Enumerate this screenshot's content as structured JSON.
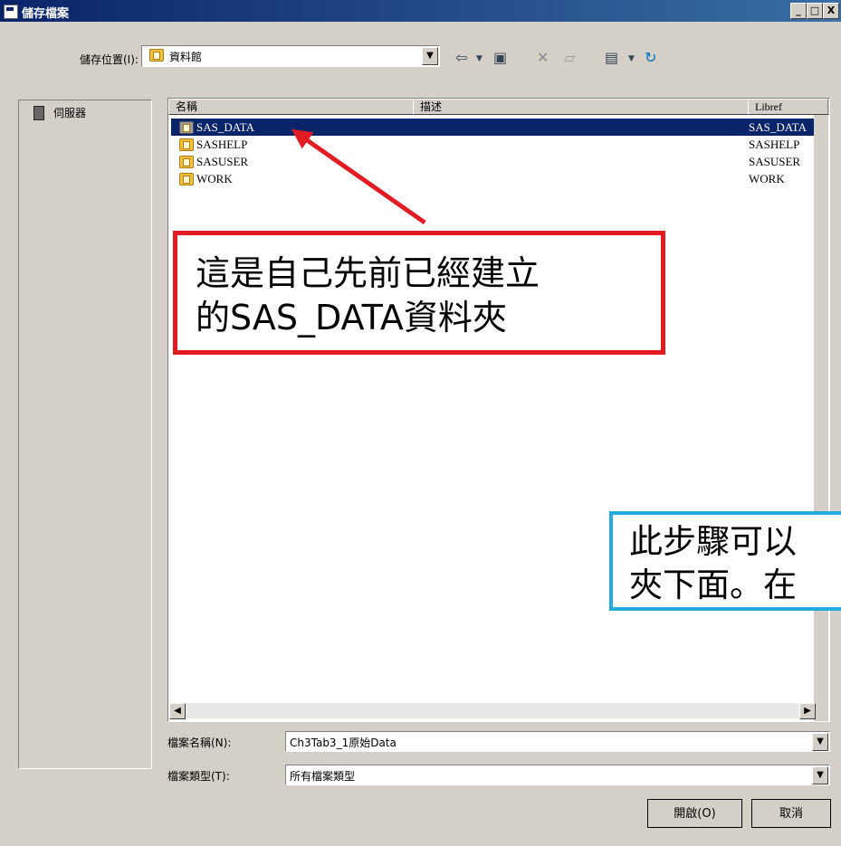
{
  "dialog": {
    "title": "儲存檔案",
    "controls": [
      "_",
      "□",
      "X"
    ]
  },
  "toolbar": {
    "save_in_label": "儲存位置(I):",
    "location": "資料館"
  },
  "sidebar": {
    "server_label": "伺服器"
  },
  "file_list": {
    "columns": [
      "名稱",
      "描述",
      "Libref"
    ],
    "rows": [
      {
        "name": "SAS_DATA",
        "libref": "SAS_DATA"
      },
      {
        "name": "SASHELP",
        "libref": "SASHELP"
      },
      {
        "name": "SASUSER",
        "libref": "SASUSER"
      },
      {
        "name": "WORK",
        "libref": "WORK"
      }
    ]
  },
  "annotations": {
    "red_line_1": "這是自己先前已經建立",
    "red_line_2": "的SAS_DATA資料夾",
    "blue_line_1": "此步驟可以",
    "blue_line_2": "夾下面。在"
  },
  "fields": {
    "filename_label": "檔案名稱(N):",
    "filename_value": "Ch3Tab3_1原始Data",
    "filetype_label": "檔案類型(T):",
    "filetype_value": "所有檔案類型"
  },
  "buttons": {
    "open": "開啟(O)",
    "cancel": "取消"
  },
  "colors": {
    "red": "#e31b23",
    "blue": "#25a9e1",
    "selected": "#0a246a"
  }
}
